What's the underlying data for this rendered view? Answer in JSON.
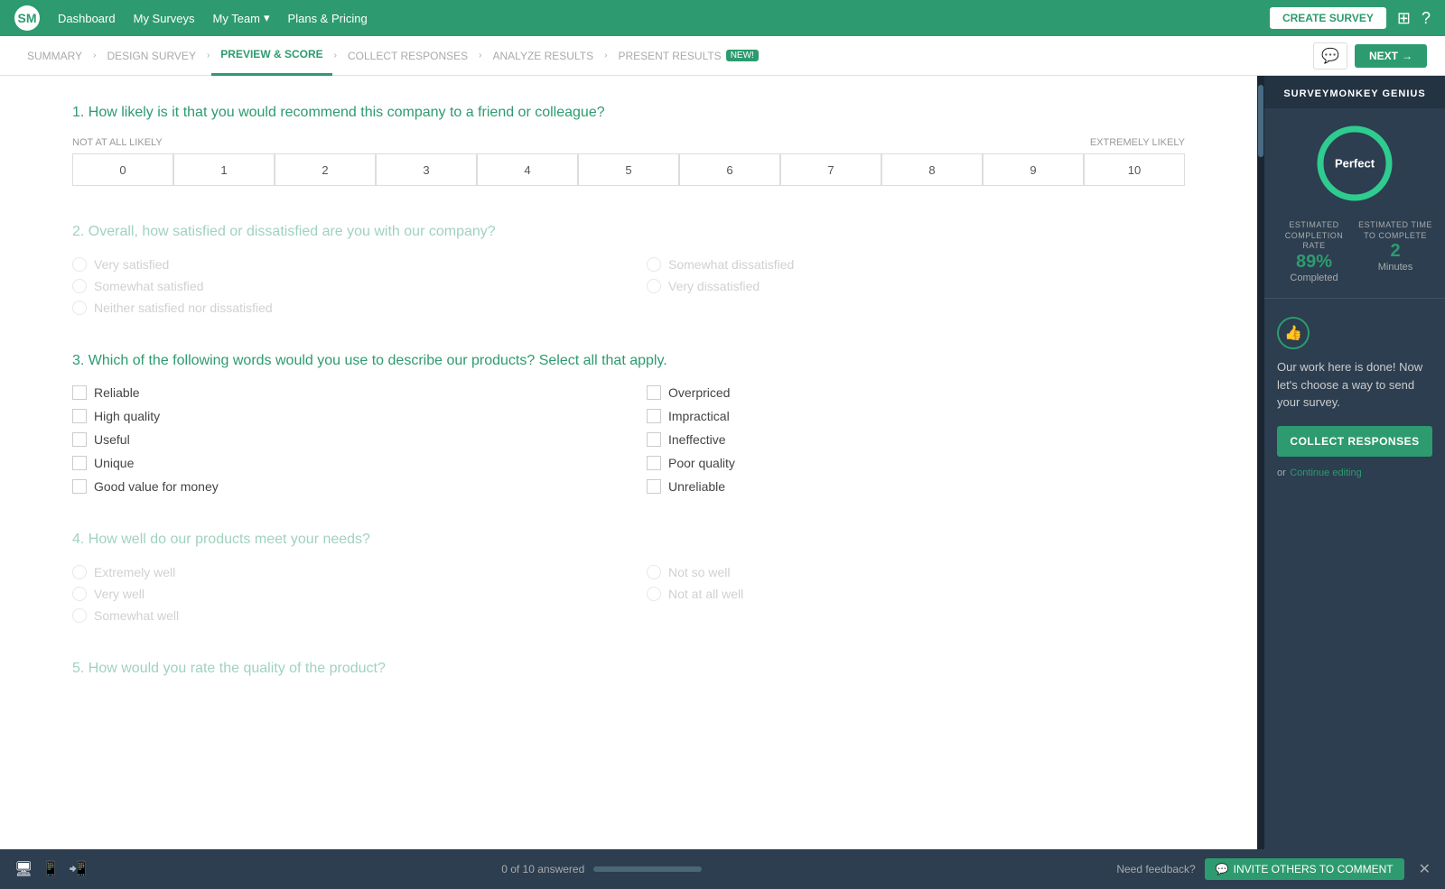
{
  "topnav": {
    "logo": "SM",
    "links": [
      "Dashboard",
      "My Surveys",
      "My Team",
      "Plans & Pricing"
    ],
    "create_survey": "CREATE SURVEY"
  },
  "breadcrumb": {
    "items": [
      {
        "label": "SUMMARY",
        "active": false
      },
      {
        "label": "DESIGN SURVEY",
        "active": false
      },
      {
        "label": "PREVIEW & SCORE",
        "active": true
      },
      {
        "label": "COLLECT RESPONSES",
        "active": false
      },
      {
        "label": "ANALYZE RESULTS",
        "active": false
      },
      {
        "label": "PRESENT RESULTS",
        "active": false,
        "badge": "NEW!"
      }
    ],
    "next": "NEXT"
  },
  "questions": [
    {
      "id": 1,
      "text": "1. How likely is it that you would recommend this company to a friend or colleague?",
      "type": "nps",
      "active": true,
      "labels": {
        "left": "NOT AT ALL LIKELY",
        "right": "EXTREMELY LIKELY"
      },
      "scale": [
        0,
        1,
        2,
        3,
        4,
        5,
        6,
        7,
        8,
        9,
        10
      ]
    },
    {
      "id": 2,
      "text": "2. Overall, how satisfied or dissatisfied are you with our company?",
      "type": "radio",
      "active": false,
      "options": [
        {
          "label": "Very satisfied",
          "col": 1
        },
        {
          "label": "Somewhat dissatisfied",
          "col": 2
        },
        {
          "label": "Somewhat satisfied",
          "col": 1
        },
        {
          "label": "Very dissatisfied",
          "col": 2
        },
        {
          "label": "Neither satisfied nor dissatisfied",
          "col": 1
        }
      ]
    },
    {
      "id": 3,
      "text": "3. Which of the following words would you use to describe our products? Select all that apply.",
      "type": "checkbox",
      "active": true,
      "options_col1": [
        "Reliable",
        "High quality",
        "Useful",
        "Unique",
        "Good value for money"
      ],
      "options_col2": [
        "Overpriced",
        "Impractical",
        "Ineffective",
        "Poor quality",
        "Unreliable"
      ]
    },
    {
      "id": 4,
      "text": "4. How well do our products meet your needs?",
      "type": "radio",
      "active": false,
      "options": [
        {
          "label": "Extremely well"
        },
        {
          "label": "Not so well"
        },
        {
          "label": "Very well"
        },
        {
          "label": "Not at all well"
        },
        {
          "label": "Somewhat well"
        }
      ]
    },
    {
      "id": 5,
      "text": "5. How would you rate the quality of the product?",
      "type": "radio",
      "active": false,
      "options": []
    }
  ],
  "right_panel": {
    "header": "SURVEYMONKEY GENIUS",
    "score": "Perfect",
    "completion_rate_label": "ESTIMATED COMPLETION RATE",
    "completion_rate_value": "89",
    "completion_rate_unit": "%",
    "completion_rate_sub": "Completed",
    "time_label": "ESTIMATED TIME TO COMPLETE",
    "time_value": "2",
    "time_unit": "Minutes",
    "body_text": "Our work here is done! Now let's choose a way to send your survey.",
    "collect_btn": "COLLECT RESPONSES",
    "or_text": "or",
    "continue_link": "Continue editing"
  },
  "bottom_bar": {
    "progress_text": "0 of 10 answered",
    "progress_pct": 0,
    "need_feedback": "Need feedback?",
    "invite_btn": "INVITE OTHERS TO COMMENT"
  }
}
